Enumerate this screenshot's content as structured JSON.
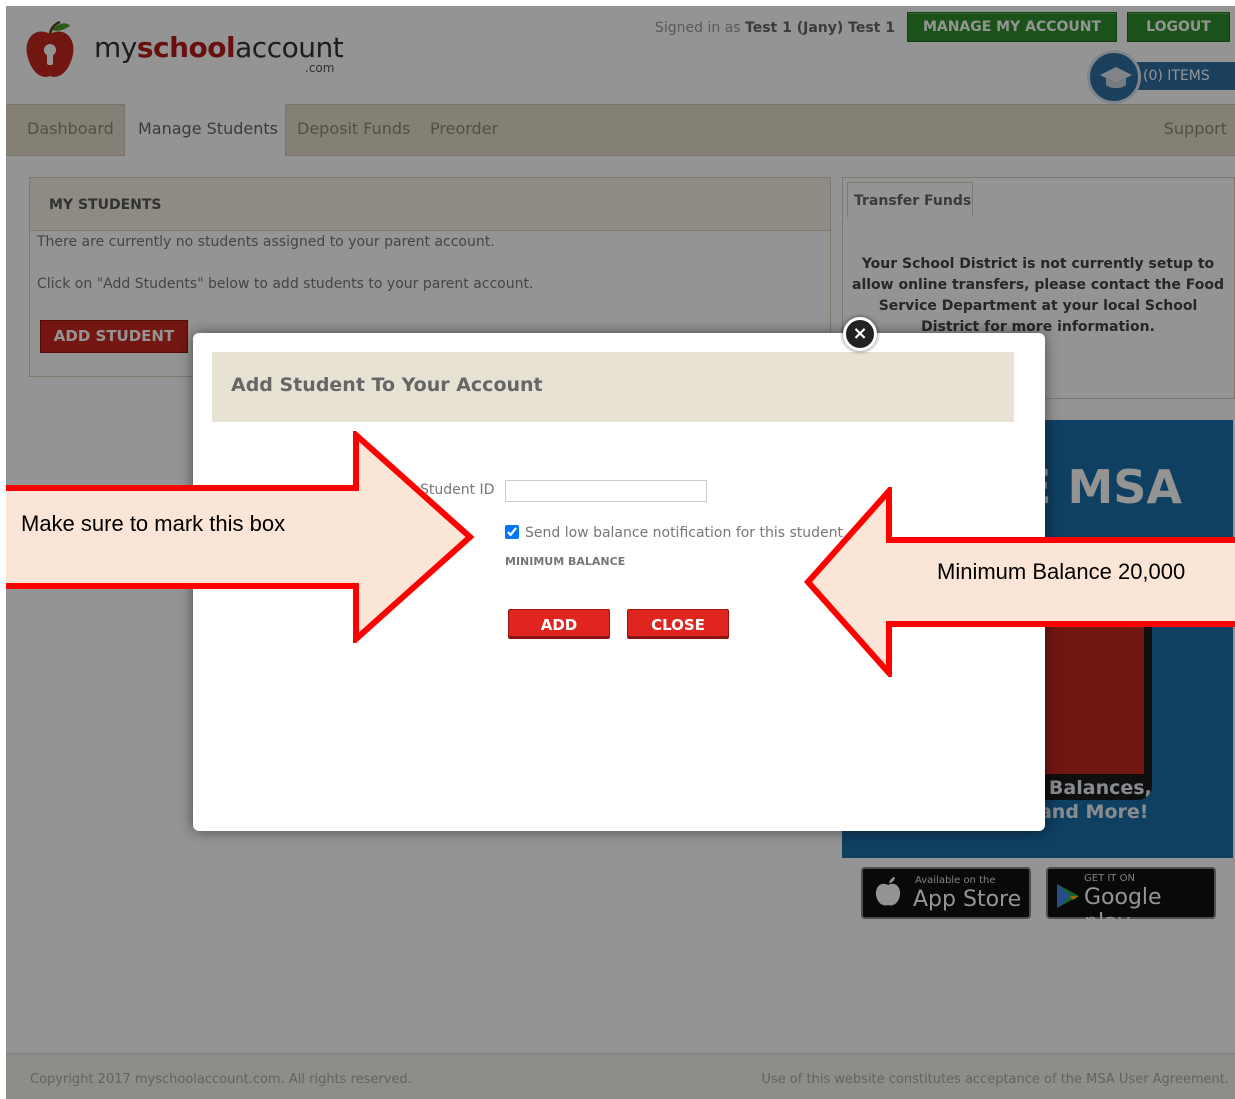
{
  "header": {
    "logo_prefix": "my",
    "logo_bold": "school",
    "logo_suffix": "account",
    "logo_com": ".com",
    "signed_in_prefix": "Signed in as",
    "signed_in_user": "Test 1 (Jany) Test 1",
    "manage_account_label": "MANAGE MY ACCOUNT",
    "logout_label": "LOGOUT",
    "cart_label": "(0) ITEMS"
  },
  "nav": {
    "items": [
      "Dashboard",
      "Manage Students",
      "Deposit Funds",
      "Preorder"
    ],
    "active": "Manage Students",
    "support": "Support"
  },
  "students": {
    "title": "MY STUDENTS",
    "line1": "There are currently no students assigned to your parent account.",
    "line2": "Click on \"Add Students\" below to add students to your parent account.",
    "add_button": "ADD STUDENT"
  },
  "transfer": {
    "tab": "Transfer Funds",
    "message": "Your School District is not currently setup to allow online transfers, please contact the Food Service Department at your local School District for more information."
  },
  "promo": {
    "headline": "E MSA",
    "line1": "heck Balances,",
    "line2": "vity and More!"
  },
  "stores": {
    "apple_small": "Available on the",
    "apple_big": "App Store",
    "google_small": "GET IT ON",
    "google_big": "Google play"
  },
  "footer": {
    "copyright": "Copyright 2017 myschoolaccount.com. All rights reserved.",
    "agreement": "Use of this website constitutes acceptance of the MSA User Agreement."
  },
  "modal": {
    "title": "Add Student To Your Account",
    "student_id_label": "Student ID",
    "student_id_value": "",
    "notification_label": "Send low balance notification for this student",
    "notification_checked": true,
    "minimum_balance_label": "MINIMUM BALANCE",
    "add_button": "ADD",
    "close_button": "CLOSE",
    "close_icon": "×"
  },
  "annotations": {
    "left": "Make sure to mark this box",
    "right": "Minimum Balance 20,000"
  },
  "colors": {
    "brand_red": "#c8261f",
    "brand_green": "#2f8d2b",
    "nav_bg": "#e3ddca",
    "arrow_red": "#ff0000",
    "arrow_fill": "#fbe5d6"
  }
}
